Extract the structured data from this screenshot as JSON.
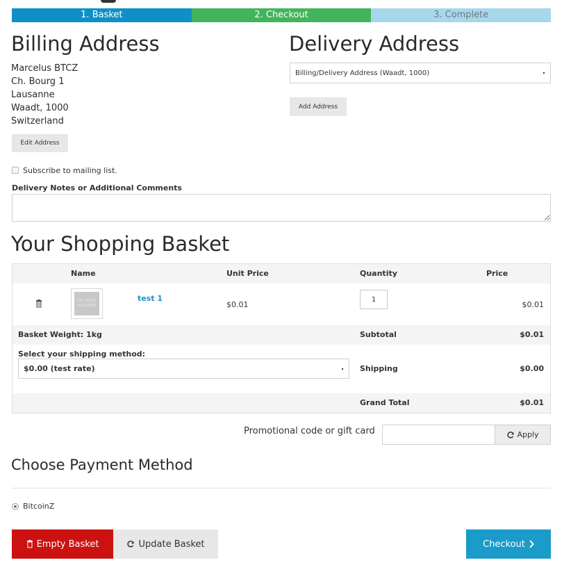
{
  "progress": {
    "steps": [
      "1. Basket",
      "2. Checkout",
      "3. Complete"
    ],
    "colors": {
      "basket": "#0e90c6",
      "checkout": "#42b45c",
      "complete": "#a7d7ea"
    }
  },
  "billing": {
    "title": "Billing Address",
    "lines": [
      "Marcelus BTCZ",
      "Ch. Bourg 1",
      "Lausanne",
      "Waadt, 1000",
      "Switzerland"
    ],
    "edit_button": "Edit Address"
  },
  "delivery": {
    "title": "Delivery Address",
    "selected": "Billing/Delivery Address (Waadt, 1000)",
    "add_button": "Add Address"
  },
  "mailing": {
    "label": "Subscribe to mailing list.",
    "checked": false
  },
  "notes": {
    "label": "Delivery Notes or Additional Comments",
    "value": ""
  },
  "basket": {
    "title": "Your Shopping Basket",
    "headers": {
      "name": "Name",
      "unit_price": "Unit Price",
      "quantity": "Quantity",
      "price": "Price"
    },
    "items": [
      {
        "name": "test 1",
        "image_placeholder": "NO IMAGE AVAILABLE",
        "unit_price": "$0.01",
        "quantity": "1",
        "price": "$0.01",
        "delete_icon": "trash-icon"
      }
    ],
    "weight": "Basket Weight: 1kg",
    "subtotal_label": "Subtotal",
    "subtotal": "$0.01",
    "shipping_prompt": "Select your shipping method:",
    "shipping_selected": "$0.00 (test rate)",
    "shipping_label": "Shipping",
    "shipping": "$0.00",
    "grand_total_label": "Grand Total",
    "grand_total": "$0.01"
  },
  "promo": {
    "label": "Promotional code or gift card",
    "value": "",
    "apply": "Apply",
    "apply_icon": "refresh-icon"
  },
  "payment": {
    "title": "Choose Payment Method",
    "options": [
      "BitcoinZ"
    ],
    "selected": "BitcoinZ"
  },
  "actions": {
    "empty": "Empty Basket",
    "update": "Update Basket",
    "checkout": "Checkout",
    "colors": {
      "empty": "#cc1111",
      "checkout": "#1a9bc9"
    }
  }
}
